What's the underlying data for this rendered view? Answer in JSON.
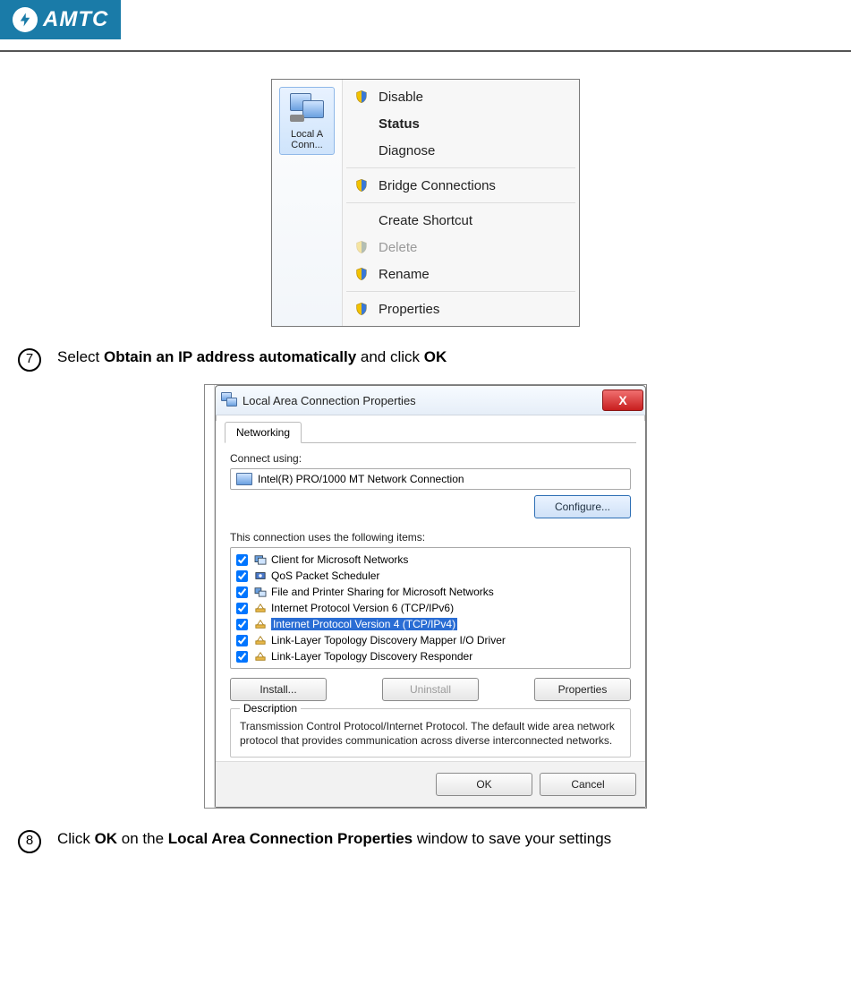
{
  "logo": {
    "text": "AMTC"
  },
  "figure1": {
    "lan_label": "Local A\nConn...",
    "menu": [
      {
        "label": "Disable",
        "icon": "shield",
        "bold": false
      },
      {
        "label": "Status",
        "icon": "",
        "bold": true
      },
      {
        "label": "Diagnose",
        "icon": "",
        "bold": false
      },
      {
        "sep": true
      },
      {
        "label": "Bridge Connections",
        "icon": "shield",
        "bold": false
      },
      {
        "sep": true
      },
      {
        "label": "Create Shortcut",
        "icon": "",
        "bold": false
      },
      {
        "label": "Delete",
        "icon": "shield",
        "bold": false,
        "disabled": true
      },
      {
        "label": "Rename",
        "icon": "shield",
        "bold": false
      },
      {
        "sep": true
      },
      {
        "label": "Properties",
        "icon": "shield",
        "bold": false
      }
    ]
  },
  "instruction7": {
    "num": "7",
    "pre": "Select ",
    "bold1": "Obtain an IP address automatically",
    "mid": " and click ",
    "bold2": "OK"
  },
  "figure2": {
    "title": "Local Area Connection Properties",
    "close": "X",
    "tab": "Networking",
    "connect_using_label": "Connect using:",
    "adapter": "Intel(R) PRO/1000 MT Network Connection",
    "configure_btn": "Configure...",
    "items_label": "This connection uses the following items:",
    "items": [
      {
        "label": "Client for Microsoft Networks",
        "icon": "client"
      },
      {
        "label": "QoS Packet Scheduler",
        "icon": "qos"
      },
      {
        "label": "File and Printer Sharing for Microsoft Networks",
        "icon": "share"
      },
      {
        "label": "Internet Protocol Version 6 (TCP/IPv6)",
        "icon": "proto"
      },
      {
        "label": "Internet Protocol Version 4 (TCP/IPv4)",
        "icon": "proto",
        "selected": true
      },
      {
        "label": "Link-Layer Topology Discovery Mapper I/O Driver",
        "icon": "proto"
      },
      {
        "label": "Link-Layer Topology Discovery Responder",
        "icon": "proto"
      }
    ],
    "install_btn": "Install...",
    "uninstall_btn": "Uninstall",
    "properties_btn": "Properties",
    "description_label": "Description",
    "description_text": "Transmission Control Protocol/Internet Protocol. The default wide area network protocol that provides communication across diverse interconnected networks.",
    "ok_btn": "OK",
    "cancel_btn": "Cancel"
  },
  "instruction8": {
    "num": "8",
    "pre": "Click ",
    "bold1": "OK",
    "mid": " on the ",
    "bold2": "Local Area Connection Properties",
    "post": " window to save your settings"
  }
}
